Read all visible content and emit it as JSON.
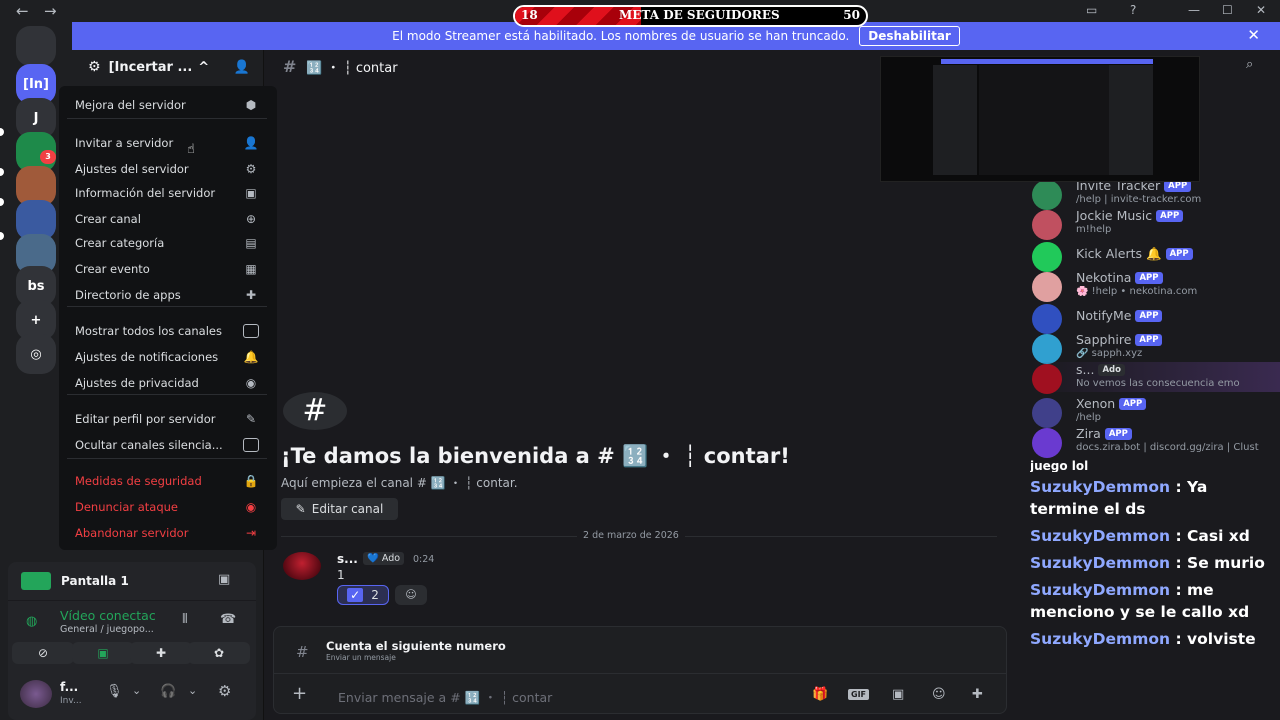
{
  "topbar": {
    "back": "←",
    "fwd": "→",
    "min": "—",
    "max": "☐",
    "close": "✕"
  },
  "goal": {
    "current": "18",
    "label": "META DE SEGUIDORES",
    "target": "50",
    "progress_fraction": 0.36
  },
  "rail": {
    "servers": [
      {
        "label": "",
        "icon": "discord-icon",
        "color": "#313338"
      },
      {
        "label": "[In]",
        "icon": "",
        "color": "#5865f2"
      },
      {
        "label": "J",
        "icon": "",
        "color": "#313338"
      },
      {
        "label": "",
        "icon": "tree-icon",
        "color": "#1e8a4a"
      },
      {
        "label": "",
        "icon": "avatar-icon",
        "color": "#a05a3a"
      },
      {
        "label": "",
        "icon": "avatar-icon",
        "color": "#3a5aa0"
      },
      {
        "label": "",
        "icon": "avatar-icon",
        "color": "#4a6a8a"
      },
      {
        "label": "bs",
        "icon": "",
        "color": "#313338"
      },
      {
        "label": "+",
        "icon": "plus-icon",
        "color": "#313338"
      },
      {
        "label": "◎",
        "icon": "compass-icon",
        "color": "#313338"
      }
    ],
    "badge": "3"
  },
  "banner": {
    "text": "El modo Streamer está habilitado. Los nombres de usuario se han truncado.",
    "button": "Deshabilitar",
    "close": "✕"
  },
  "sidebar": {
    "server_name": "[Incertar ...",
    "chevron": "^"
  },
  "menu": {
    "items": [
      {
        "label": "Mejora del servidor",
        "icon": "⬢",
        "red": false
      },
      {
        "label": "Invitar a servidor",
        "icon": "👤",
        "red": false
      },
      {
        "label": "Ajustes del servidor",
        "icon": "⚙",
        "red": false
      },
      {
        "label": "Información del servidor",
        "icon": "▣",
        "red": false
      },
      {
        "label": "Crear canal",
        "icon": "⊕",
        "red": false
      },
      {
        "label": "Crear categoría",
        "icon": "▤",
        "red": false
      },
      {
        "label": "Crear evento",
        "icon": "▦",
        "red": false
      },
      {
        "label": "Directorio de apps",
        "icon": "✚",
        "red": false
      },
      {
        "label": "Mostrar todos los canales",
        "icon": "",
        "red": false,
        "checkbox": true
      },
      {
        "label": "Ajustes de notificaciones",
        "icon": "🔔",
        "red": false
      },
      {
        "label": "Ajustes de privacidad",
        "icon": "◉",
        "red": false
      },
      {
        "label": "Editar perfil por servidor",
        "icon": "✎",
        "red": false
      },
      {
        "label": "Ocultar canales silencia...",
        "icon": "",
        "red": false,
        "checkbox": true
      },
      {
        "label": "Medidas de seguridad",
        "icon": "🔒",
        "red": true
      },
      {
        "label": "Denunciar ataque",
        "icon": "◉",
        "red": true
      },
      {
        "label": "Abandonar servidor",
        "icon": "⇥",
        "red": true
      }
    ]
  },
  "channel": {
    "name": "🔢 ・ ┆ contar",
    "hash": "#"
  },
  "welcome": {
    "title": "¡Te damos la bienvenida a # 🔢 ・ ┆ contar!",
    "sub": "Aquí empieza el canal # 🔢 ・ ┆ contar.",
    "edit": "Editar canal"
  },
  "divider": "2 de marzo de 2026",
  "message": {
    "author": "s...",
    "tag": "Ado",
    "time": "0:24",
    "text": "1",
    "reaction": "2"
  },
  "composer": {
    "topic": "Cuenta el siguiente numero",
    "topic_sub": "Enviar un mensaje",
    "placeholder": "Enviar mensaje a # 🔢 ・ ┆ contar"
  },
  "userbar": {
    "stream": "Pantalla 1",
    "voice": "Vídeo conectac",
    "voice_sub": "General / juegopo...",
    "user": "f...",
    "user_sub": "Inv..."
  },
  "members": [
    {
      "name": "Invite Tracker",
      "sub": "/help | invite-tracker.com",
      "app": "APP",
      "color": "#2e8b57"
    },
    {
      "name": "Jockie Music",
      "sub": "m!help",
      "app": "APP",
      "color": "#c05060"
    },
    {
      "name": "Kick Alerts 🔔",
      "sub": "",
      "app": "APP",
      "color": "#21c95a"
    },
    {
      "name": "Nekotina",
      "sub": "🌸 !help • nekotina.com",
      "app": "APP",
      "color": "#e0a0a0"
    },
    {
      "name": "NotifyMe",
      "sub": "",
      "app": "APP",
      "color": "#3050c0"
    },
    {
      "name": "Sapphire",
      "sub": "🔗 sapph.xyz",
      "app": "APP",
      "color": "#30a0d0"
    },
    {
      "name": "s...",
      "sub": "No vemos las consecuencia emo",
      "app": "Ado",
      "color": "#a01020"
    },
    {
      "name": "Xenon",
      "sub": "/help",
      "app": "APP",
      "color": "#40408a"
    },
    {
      "name": "Zira",
      "sub": "docs.zira.bot | discord.gg/zira | Clust",
      "app": "APP",
      "color": "#6a3ad0"
    }
  ],
  "chat": [
    {
      "user": "",
      "text": "juego lol"
    },
    {
      "user": "SuzukyDemmon",
      "text": ": Ya termine el ds"
    },
    {
      "user": "SuzukyDemmon",
      "text": ": Casi xd"
    },
    {
      "user": "SuzukyDemmon",
      "text": ": Se murio"
    },
    {
      "user": "SuzukyDemmon",
      "text": ": me menciono y se le callo xd"
    },
    {
      "user": "SuzukyDemmon",
      "text": ": volviste"
    }
  ]
}
